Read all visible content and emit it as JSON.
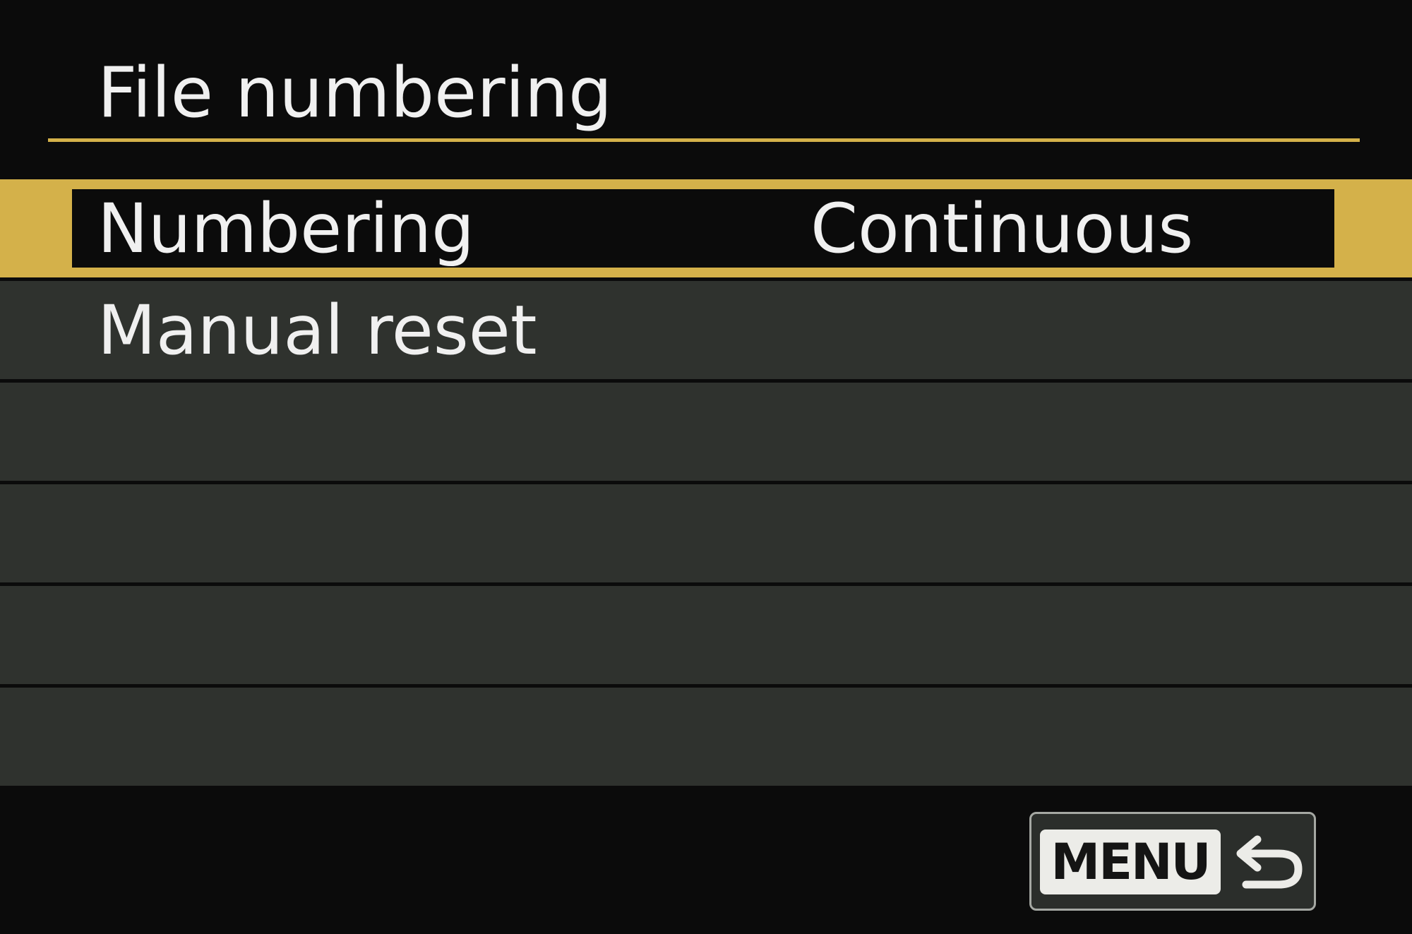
{
  "header": {
    "title": "File numbering"
  },
  "menu": {
    "items": [
      {
        "label": "Numbering",
        "value": "Continuous",
        "selected": true
      },
      {
        "label": "Manual reset",
        "value": "",
        "selected": false
      },
      {
        "label": "",
        "value": "",
        "selected": false
      },
      {
        "label": "",
        "value": "",
        "selected": false
      },
      {
        "label": "",
        "value": "",
        "selected": false
      },
      {
        "label": "",
        "value": "",
        "selected": false
      }
    ]
  },
  "footer": {
    "menu_button_label": "MENU",
    "return_icon": "return-arrow-icon"
  },
  "colors": {
    "background": "#0b0b0b",
    "accent": "#d4b14a",
    "row": "#2f322e",
    "text": "#f0f0f0"
  }
}
